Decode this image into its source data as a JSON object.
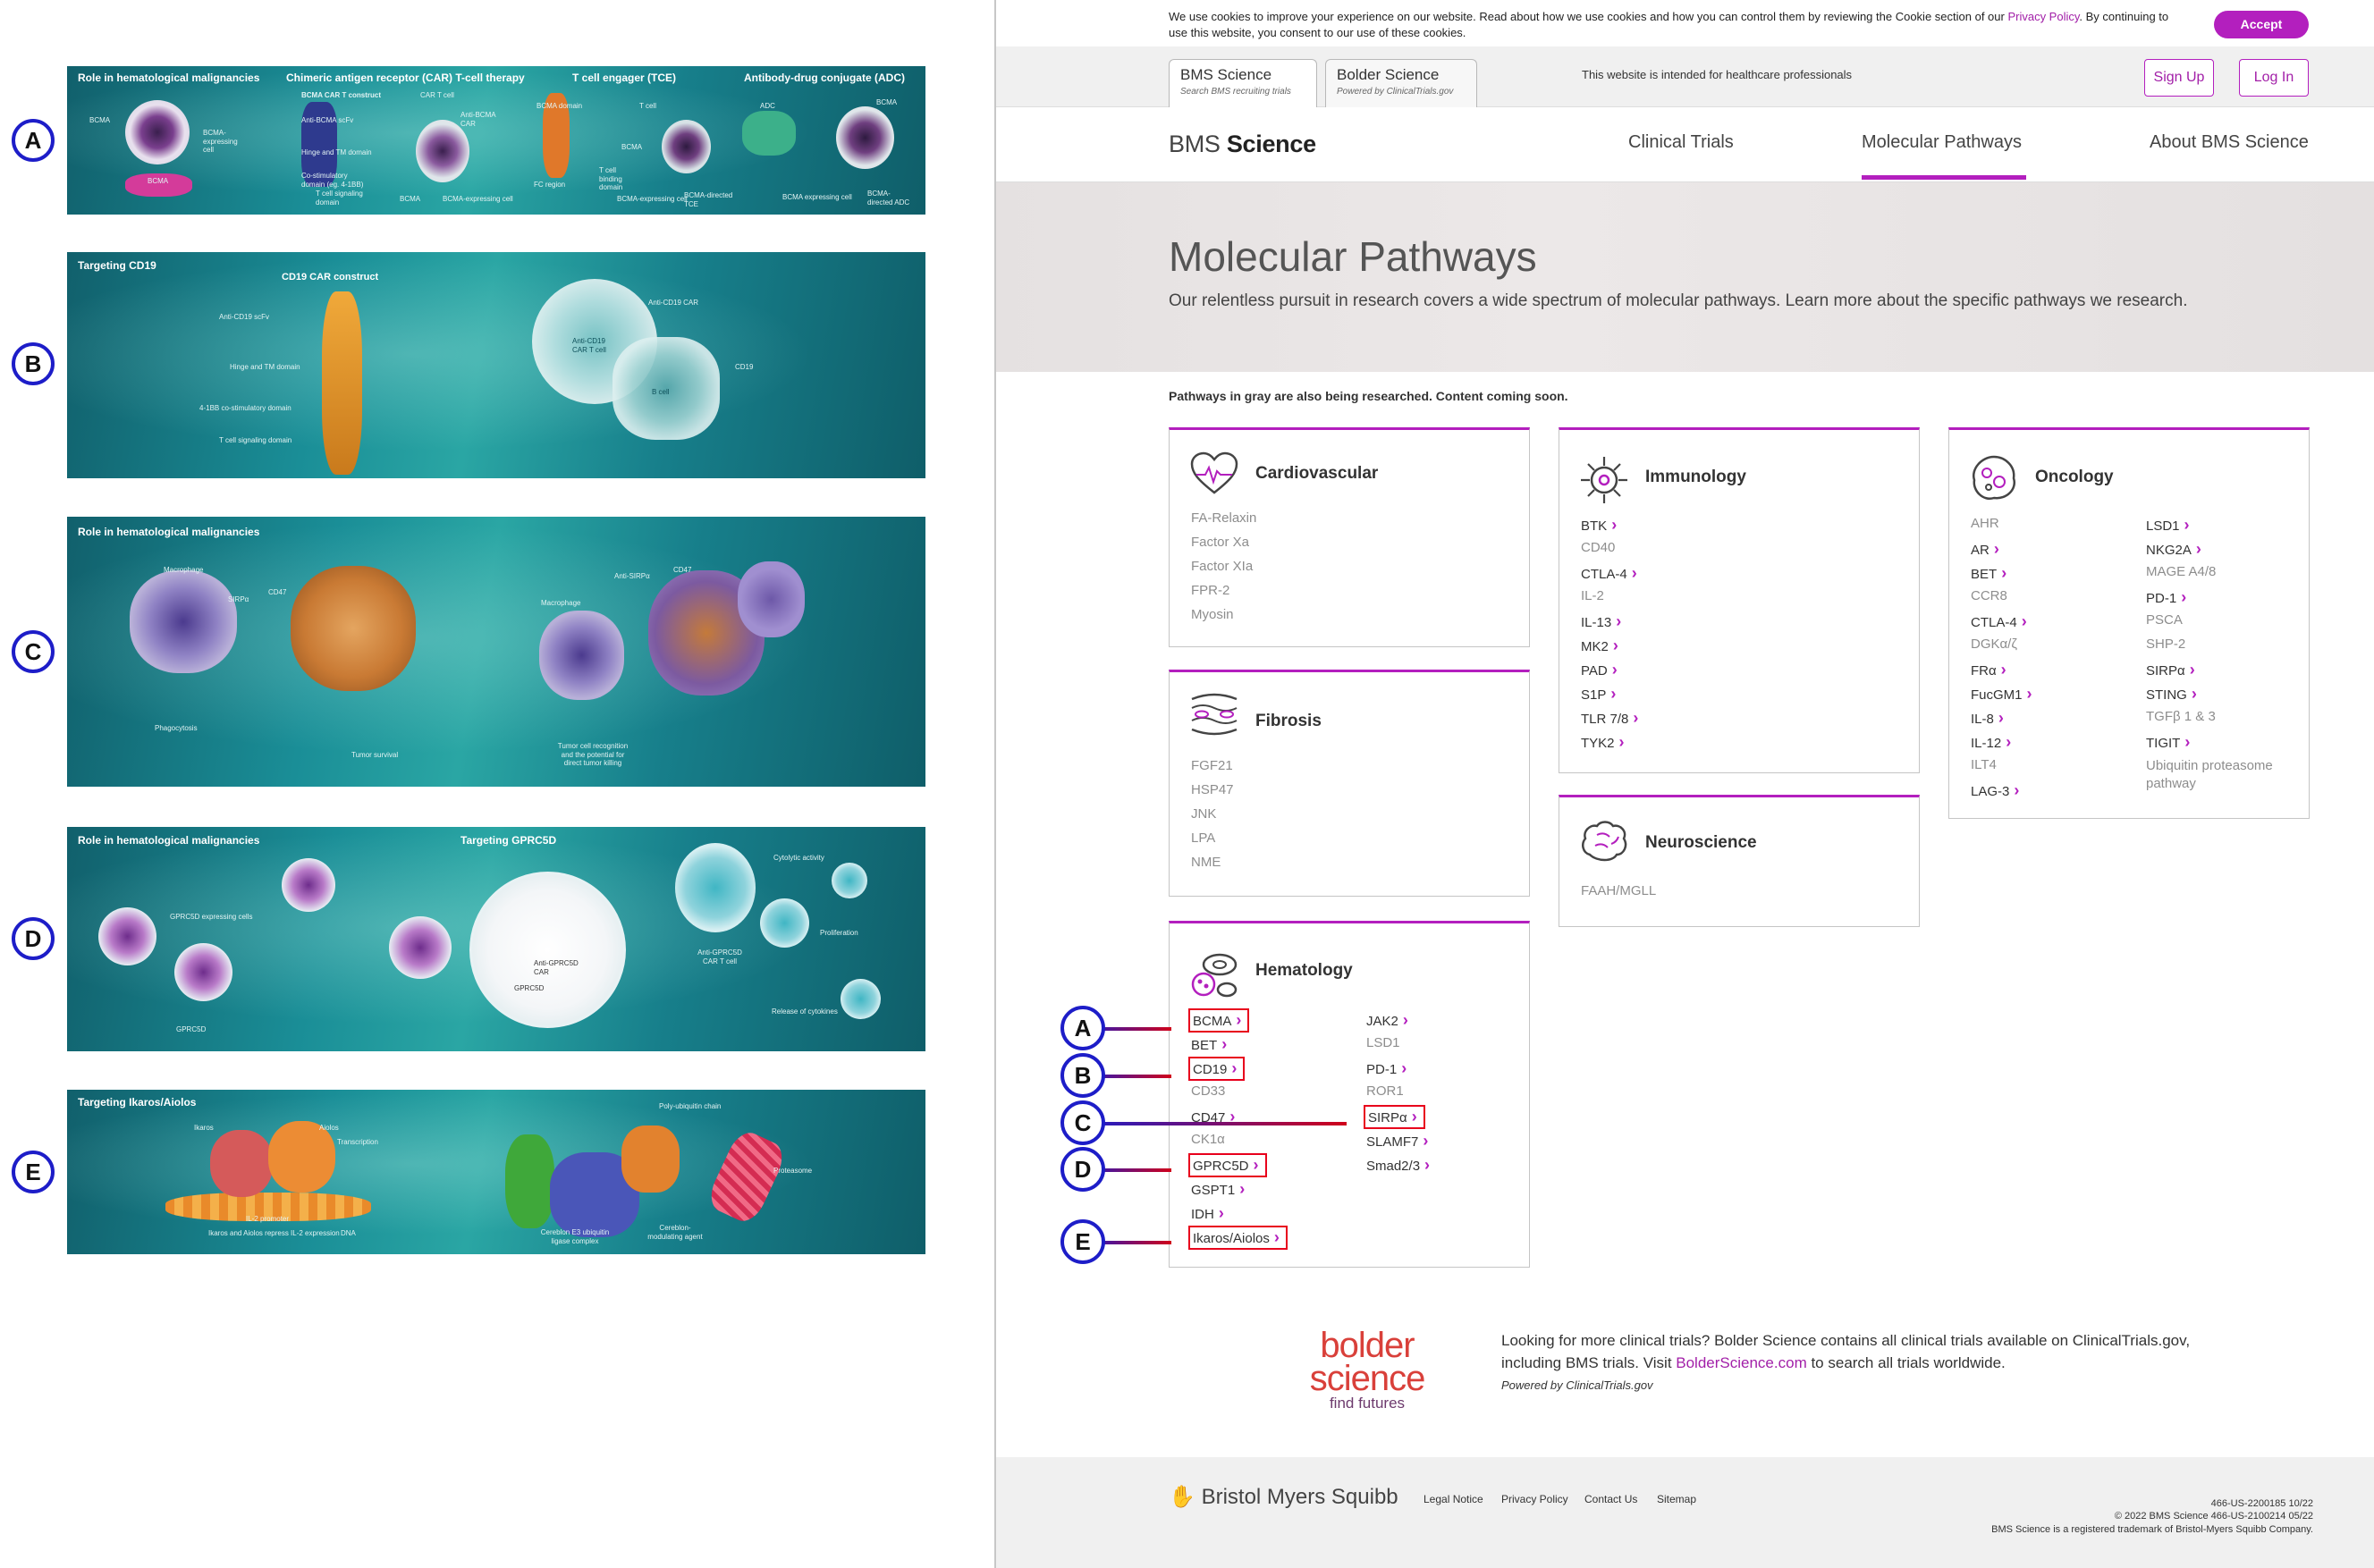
{
  "panels": {
    "A": {
      "headings": [
        "Role in hematological malignancies",
        "Chimeric antigen receptor (CAR) T-cell therapy",
        "T cell engager (TCE)",
        "Antibody-drug conjugate (ADC)"
      ],
      "labels": [
        "BCMA",
        "BCMA-expressing cell",
        "BCMA",
        "BCMA CAR T construct",
        "Anti-BCMA scFv",
        "Hinge and TM domain",
        "Co-stimulatory domain (eg. 4-1BB)",
        "T cell signaling domain",
        "CAR T cell",
        "Anti-BCMA CAR",
        "BCMA",
        "BCMA-expressing cell",
        "BCMA domain",
        "T cell",
        "BCMA",
        "T cell binding domain",
        "FC region",
        "BCMA-expressing cell",
        "BCMA-directed TCE",
        "ADC",
        "BCMA",
        "BCMA expressing cell",
        "BCMA-directed ADC"
      ]
    },
    "B": {
      "headings": [
        "Targeting CD19",
        "CD19 CAR construct"
      ],
      "labels": [
        "Anti-CD19 scFv",
        "Hinge and TM domain",
        "4-1BB co-stimulatory domain",
        "T cell signaling domain",
        "Anti-CD19 CAR",
        "Anti-CD19 CAR T cell",
        "CD19",
        "B cell"
      ]
    },
    "C": {
      "headings": [
        "Role in hematological malignancies"
      ],
      "labels": [
        "Macrophage",
        "SIRPα",
        "CD47",
        "Anti-SIRPα",
        "Macrophage",
        "CD47",
        "Phagocytosis",
        "Tumor survival",
        "Tumor cell recognition and the potential for direct tumor killing"
      ]
    },
    "D": {
      "headings": [
        "Role in hematological malignancies",
        "Targeting GPRC5D"
      ],
      "labels": [
        "GPRC5D expressing cells",
        "GPRC5D",
        "Anti-GPRC5D CAR",
        "GPRC5D",
        "Anti-GPRC5D CAR T cell",
        "Cytolytic activity",
        "Proliferation",
        "Release of cytokines"
      ]
    },
    "E": {
      "headings": [
        "Targeting Ikaros/Aiolos"
      ],
      "labels": [
        "Ikaros",
        "Aiolos",
        "Transcription",
        "IL-2 promoter",
        "Ikaros and Aiolos repress IL-2 expression",
        "DNA",
        "Poly-ubiquitin chain",
        "Proteasome",
        "Cereblon E3 ubiquitin ligase complex",
        "Cereblon-modulating agent"
      ]
    }
  },
  "markers": [
    "A",
    "B",
    "C",
    "D",
    "E"
  ],
  "cookie": {
    "text": "We use cookies to improve your experience on our website. Read about how we use cookies and how you can control them by reviewing the Cookie section of our ",
    "link": "Privacy Policy",
    "text2": ". By continuing to use this website, you consent to our use of these cookies.",
    "accept": "Accept"
  },
  "topbar": {
    "tab1_title": "BMS Science",
    "tab1_sub": "Search BMS recruiting trials",
    "tab2_title": "Bolder Science",
    "tab2_sub": "Powered by ClinicalTrials.gov",
    "intended": "This website is intended for healthcare professionals",
    "signup": "Sign Up",
    "login": "Log In"
  },
  "nav": {
    "logo_a": "BMS ",
    "logo_b": "Science",
    "links": [
      "Clinical Trials",
      "Molecular Pathways",
      "About BMS Science"
    ]
  },
  "hero": {
    "title": "Molecular Pathways",
    "subtitle": "Our relentless pursuit in research covers a wide spectrum of molecular pathways. Learn more about the specific pathways we research."
  },
  "note": "Pathways in gray are also being researched. Content coming soon.",
  "cards": {
    "cardiovascular": {
      "title": "Cardiovascular",
      "items": [
        "FA-Relaxin",
        "Factor Xa",
        "Factor XIa",
        "FPR-2",
        "Myosin"
      ]
    },
    "fibrosis": {
      "title": "Fibrosis",
      "items": [
        "FGF21",
        "HSP47",
        "JNK",
        "LPA",
        "NME"
      ]
    },
    "hematology": {
      "title": "Hematology",
      "col1": [
        "BCMA",
        "BET",
        "CD19",
        "CD33",
        "CD47",
        "CK1α",
        "GPRC5D",
        "GSPT1",
        "IDH",
        "Ikaros/Aiolos"
      ],
      "col2": [
        "JAK2",
        "LSD1",
        "PD-1",
        "ROR1",
        "SIRPα",
        "SLAMF7",
        "Smad2/3"
      ]
    },
    "immunology": {
      "title": "Immunology",
      "items": [
        "BTK",
        "CD40",
        "CTLA-4",
        "IL-2",
        "IL-13",
        "MK2",
        "PAD",
        "S1P",
        "TLR 7/8",
        "TYK2"
      ]
    },
    "neuroscience": {
      "title": "Neuroscience",
      "items": [
        "FAAH/MGLL"
      ]
    },
    "oncology": {
      "title": "Oncology",
      "col1": [
        "AHR",
        "AR",
        "BET",
        "CCR8",
        "CTLA-4",
        "DGKα/ζ",
        "FRα",
        "FucGM1",
        "IL-8",
        "IL-12",
        "ILT4",
        "LAG-3"
      ],
      "col2": [
        "LSD1",
        "NKG2A",
        "MAGE A4/8",
        "PD-1",
        "PSCA",
        "SHP-2",
        "SIRPα",
        "STING",
        "TGFβ 1 & 3",
        "TIGIT",
        "Ubiquitin proteasome pathway"
      ]
    }
  },
  "bolder": {
    "logo_a": "bolder",
    "logo_b": "science",
    "tagline": "find futures",
    "text1": "Looking for more clinical trials? Bolder Science contains all clinical trials available on ClinicalTrials.gov, including BMS trials. Visit ",
    "link": "BolderScience.com",
    "text2": " to search all trials worldwide.",
    "powered": "Powered by ClinicalTrials.gov"
  },
  "footer": {
    "logo": "Bristol Myers Squibb",
    "links": [
      "Legal Notice",
      "Privacy Policy",
      "Contact Us",
      "Sitemap"
    ],
    "legal": [
      "466-US-2200185 10/22",
      "© 2022 BMS Science 466-US-2100214 05/22",
      "BMS Science is a registered trademark of Bristol-Myers Squibb Company."
    ]
  },
  "colors": {
    "accent": "#b31fbe",
    "callout_blue": "#1d1dc8",
    "highlight_red": "#e8001c",
    "panel_teal": "#1a8e97"
  }
}
